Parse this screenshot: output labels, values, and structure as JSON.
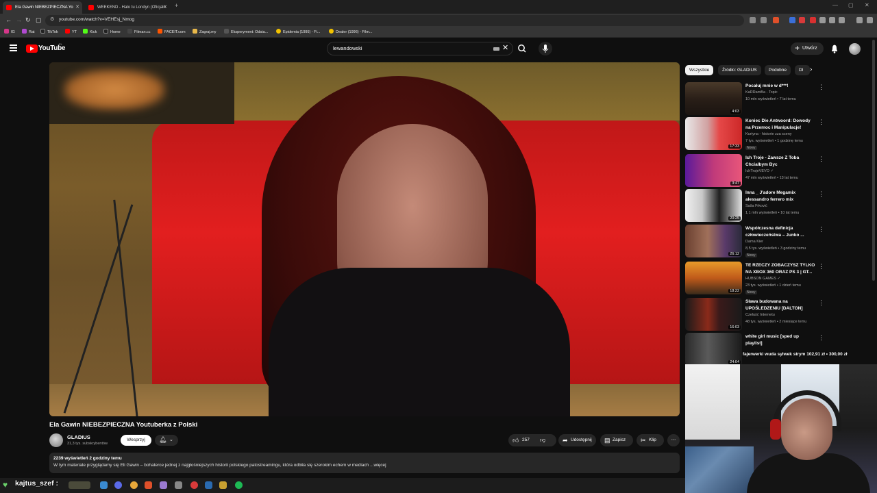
{
  "browser": {
    "tabs": [
      {
        "label": "Ela Gawin NIEBEZPIECZNA Yo",
        "active": true
      },
      {
        "label": "WEEKEND - Halo tu Londyn (Oficjaln",
        "active": false
      }
    ],
    "url": "youtube.com/watch?v=VEHEsj_Nmog",
    "bookmarks": [
      "IG",
      "Rat",
      "TikTok",
      "YT",
      "Kick",
      "Home",
      "Filman.cc",
      "FACEIT.com",
      "Zagraj.my",
      "Eksperyment: Odsia...",
      "Epidemia (1995) - Fi...",
      "Dealer (1996) - Film..."
    ]
  },
  "header": {
    "logo_text": "YouTube",
    "country": "PL",
    "search_value": "lewandowski",
    "create_label": "Utwórz"
  },
  "video": {
    "title": "Ela Gawin NIEBEZPIECZNA Youtuberka z Polski",
    "channel": "GLADIUS",
    "subs": "31,3 tys. subskrybentów",
    "support_label": "Wesprzyj",
    "likes": "257",
    "share_label": "Udostępnij",
    "save_label": "Zapisz",
    "clip_label": "Klip",
    "desc_meta": "2239 wyświetleń  2 godziny temu",
    "desc_text": "W tym materiale przyglądamy się Eli Gawin – bohaterce jednej z najgłośniejszych historii polskiego patostreamingu, która odbiła się szerokim echem w mediach ...więcej"
  },
  "chips": [
    "Wszystkie",
    "Źródło: GLADIUS",
    "Podobne",
    "Dl"
  ],
  "recommendations": [
    {
      "title": "Pocałuj mnie w d***!",
      "channel": "KaRRamBa - Topic",
      "meta": "10 mln wyświetleń • 7 lat temu",
      "duration": "4:03",
      "badge": ""
    },
    {
      "title": "Koniec Die Antwoord: Dowody na Przemoc i Manipulacje!",
      "channel": "Kurtyna - historie zza sceny",
      "meta": "7 tys. wyświetleń • 1 godzinę temu",
      "duration": "17:33",
      "badge": "Nowy"
    },
    {
      "title": "Ich Troje - Zawsze Z Toba Chcialbym Byc",
      "channel": "IchTrojeVEVO ✓",
      "meta": "47 mln wyświetleń • 13 lat temu",
      "duration": "3:47",
      "badge": ""
    },
    {
      "title": "Inna _ J'adore Megamix alessandro ferrero mix",
      "channel": "Saša Frković",
      "meta": "1,1 mln wyświetleń • 10 lat temu",
      "duration": "20:25",
      "badge": ""
    },
    {
      "title": "Współczesna definicja człowieczeństwa – Junko ...",
      "channel": "Dama Kier",
      "meta": "8,5 tys. wyświetleń • 3 godziny temu",
      "duration": "26:12",
      "badge": "Nowy"
    },
    {
      "title": "TE RZECZY ZOBACZYSZ TYLKO NA XBOX 360 ORAZ PS 3 | GT...",
      "channel": "HUBSON GAMES ✓",
      "meta": "23 tys. wyświetleń • 1 dzień temu",
      "duration": "18:22",
      "badge": "Nowy"
    },
    {
      "title": "Sława budowana na UPOŚLEDZENIU [DALTON]",
      "channel": "Czeluść Internetu",
      "meta": "48 tys. wyświetleń • 2 miesiące temu",
      "duration": "16:03",
      "badge": ""
    },
    {
      "title": "white girl music [sped up playlist]",
      "channel": "",
      "meta": "",
      "duration": "24:04",
      "badge": ""
    }
  ],
  "overlay": {
    "text": "fajerwerki wuda sylwek strym  102,91 zł  •  300,00 zł",
    "streamer": "kajtus_szef :"
  },
  "colors": {
    "accent": "#ff0000",
    "bg": "#0f0f0f",
    "chip": "#272727"
  }
}
